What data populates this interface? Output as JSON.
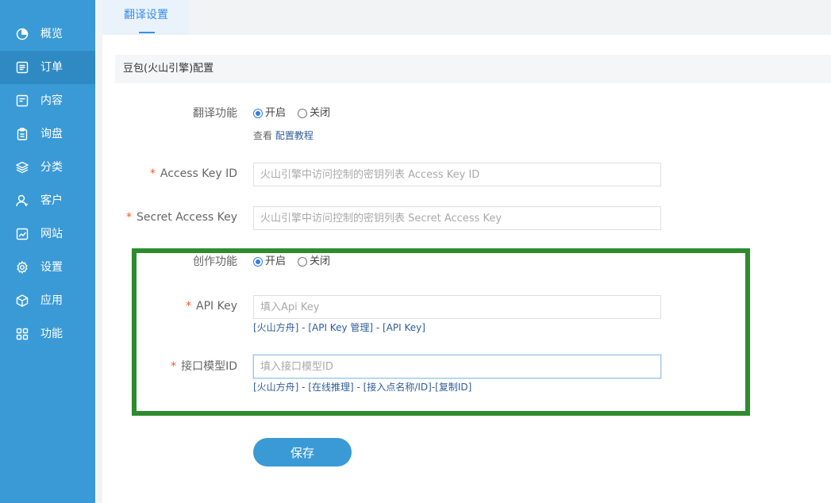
{
  "sidebar": {
    "items": [
      {
        "label": "概览",
        "icon": "pie-chart-icon"
      },
      {
        "label": "订单",
        "icon": "list-icon",
        "active": true
      },
      {
        "label": "内容",
        "icon": "document-icon"
      },
      {
        "label": "询盘",
        "icon": "clipboard-icon"
      },
      {
        "label": "分类",
        "icon": "layers-icon"
      },
      {
        "label": "客户",
        "icon": "user-icon"
      },
      {
        "label": "网站",
        "icon": "chart-icon"
      },
      {
        "label": "设置",
        "icon": "gear-icon"
      },
      {
        "label": "应用",
        "icon": "cube-icon"
      },
      {
        "label": "功能",
        "icon": "grid-icon"
      }
    ]
  },
  "tabs": [
    {
      "label": "翻译设置",
      "active": true
    }
  ],
  "section": {
    "title": "豆包(火山引擎)配置"
  },
  "form": {
    "translate": {
      "label": "翻译功能",
      "on_label": "开启",
      "off_label": "关闭",
      "selected": "on",
      "help_prefix": "查看",
      "help_link": "配置教程"
    },
    "access_key": {
      "required_mark": "*",
      "label": "Access Key ID",
      "value": "",
      "placeholder": "火山引擎中访问控制的密钥列表 Access Key ID"
    },
    "secret_key": {
      "required_mark": "*",
      "label": "Secret Access Key",
      "value": "",
      "placeholder": "火山引擎中访问控制的密钥列表 Secret Access Key"
    },
    "creation": {
      "label": "创作功能",
      "on_label": "开启",
      "off_label": "关闭",
      "selected": "on"
    },
    "api_key": {
      "required_mark": "*",
      "label": "API Key",
      "value": "",
      "placeholder": "填入Api Key",
      "help": "[火山方舟] - [API Key 管理] - [API Key]"
    },
    "model_id": {
      "required_mark": "*",
      "label": "接口模型ID",
      "value": "",
      "placeholder": "填入接口模型ID",
      "help": "[火山方舟] - [在线推理] - [接入点名称/ID]-[复制ID]"
    },
    "save_label": "保存"
  },
  "colors": {
    "sidebar_bg": "#3a9ad6",
    "accent": "#3a8ee6",
    "highlight_border": "#2e8b2e",
    "required": "#f05a23"
  }
}
